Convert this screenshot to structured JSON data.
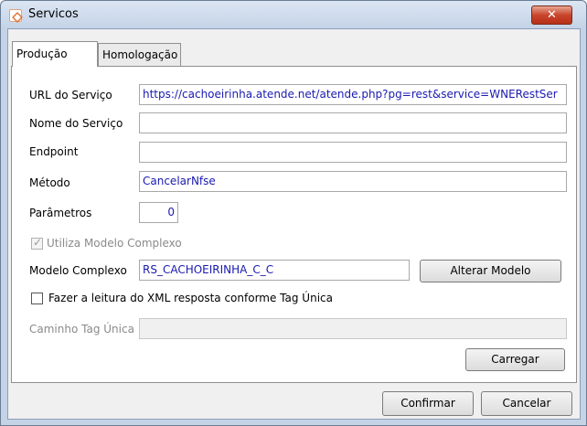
{
  "window": {
    "title": "Servicos",
    "close_symbol": "✕"
  },
  "tabs": [
    {
      "label": "Produção",
      "active": true
    },
    {
      "label": "Homologação",
      "active": false
    }
  ],
  "form": {
    "url": {
      "label": "URL do Serviço",
      "value": "https://cachoeirinha.atende.net/atende.php?pg=rest&service=WNERestSer"
    },
    "nome": {
      "label": "Nome do Serviço",
      "value": ""
    },
    "endpoint": {
      "label": "Endpoint",
      "value": ""
    },
    "metodo": {
      "label": "Método",
      "value": "CancelarNfse"
    },
    "parametros": {
      "label": "Parâmetros",
      "value": "0"
    },
    "utiliza_modelo": {
      "label": "Utiliza Modelo Complexo",
      "checked": true,
      "disabled": true
    },
    "modelo": {
      "label": "Modelo Complexo",
      "value": "RS_CACHOEIRINHA_C_C",
      "button": "Alterar Modelo"
    },
    "tag_unica": {
      "label": "Fazer a leitura do XML resposta conforme Tag Única",
      "checked": false
    },
    "caminho": {
      "label": "Caminho Tag Única",
      "value": ""
    },
    "carregar_button": "Carregar"
  },
  "footer": {
    "confirm_button": "Confirmar",
    "cancel_button": "Cancelar"
  },
  "colors": {
    "value_text": "#1a1ab0",
    "close_button": "#c8452c"
  }
}
